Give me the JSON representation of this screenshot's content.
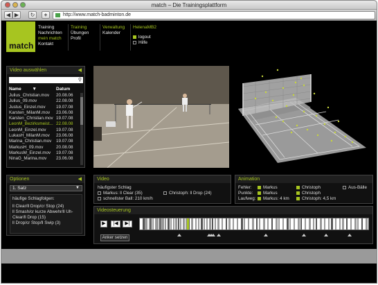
{
  "browser": {
    "title": "match – Die Trainingsplattform",
    "url": "http://www.match-badminton.de"
  },
  "site": {
    "logo": "match",
    "nav": {
      "col1": [
        "Training",
        "Nachrichten",
        "mein match",
        "Kontakt"
      ],
      "col2_head": "Training",
      "col2": [
        "Übungen",
        "Profil"
      ],
      "col3_head": "Verwaltung",
      "col3": [
        "Kalender"
      ],
      "user": "HelenaMB2",
      "user_links": [
        "logout",
        "Hilfe"
      ]
    }
  },
  "video_select": {
    "title": "Video auswählen",
    "col_name": "Name",
    "col_date": "Datum",
    "files": [
      {
        "name": "Julius_Christian.mov",
        "date": "20.08.06"
      },
      {
        "name": "Julius_09.mov",
        "date": "22.08.08"
      },
      {
        "name": "Justus_Einzel.mov",
        "date": "19.07.08"
      },
      {
        "name": "Karsten_MilanM.mov",
        "date": "23.06.08"
      },
      {
        "name": "Karsten_Christian.mov",
        "date": "19.07.08"
      },
      {
        "name": "LeonM_Bezirksmeist...",
        "date": "22.08.08",
        "highlight": true
      },
      {
        "name": "LeonM_Einzel.mov",
        "date": "19.07.08"
      },
      {
        "name": "LukasH_MilanM.mov",
        "date": "23.06.08"
      },
      {
        "name": "Marina_Christian.mov",
        "date": "19.07.08"
      },
      {
        "name": "MarkusH_09.mov",
        "date": "20.08.08"
      },
      {
        "name": "MarkusM_Einzel.mov",
        "date": "19.07.08"
      },
      {
        "name": "NinaG_Marina.mov",
        "date": "23.06.08"
      }
    ]
  },
  "options": {
    "title": "Optionen",
    "set_value": "1. Satz",
    "body_title": "häufige Schlagfolgen:",
    "sequences": [
      "ll Clear/ll Drop/cr Stop (24)",
      "ll Smash/cr kurze Abwehr/ll Uh-Clear/ll Drop (15)",
      "ll Drop/cr Stop/ll Swip (3)"
    ]
  },
  "video_panel": {
    "title": "Video",
    "stroke_label": "häufigster Schlag",
    "markus": "Markus: ll Clear (35)",
    "christoph": "Christoph: ll Drop (24)",
    "fastest": "schnellster Ball: 210 km/h"
  },
  "animation": {
    "title": "Animation",
    "rows": [
      {
        "label": "Fehler:",
        "a": "Markus",
        "b": "Christoph",
        "c": "Aus-Bälle"
      },
      {
        "label": "Punkte:",
        "a": "Markus",
        "b": "Christoph",
        "c": ""
      },
      {
        "label": "Laufweg:",
        "a": "Markus: 4 km",
        "b": "Christoph: 4,5 km",
        "c": ""
      }
    ]
  },
  "video_control": {
    "title": "Videosteuerung",
    "anchor_button": "Anker setzen",
    "play_icon": "play-icon",
    "step_back_icon": "step-back-icon",
    "step_forward_icon": "step-forward-icon"
  },
  "colors": {
    "accent": "#a7c520",
    "panel_bg": "#111111"
  }
}
